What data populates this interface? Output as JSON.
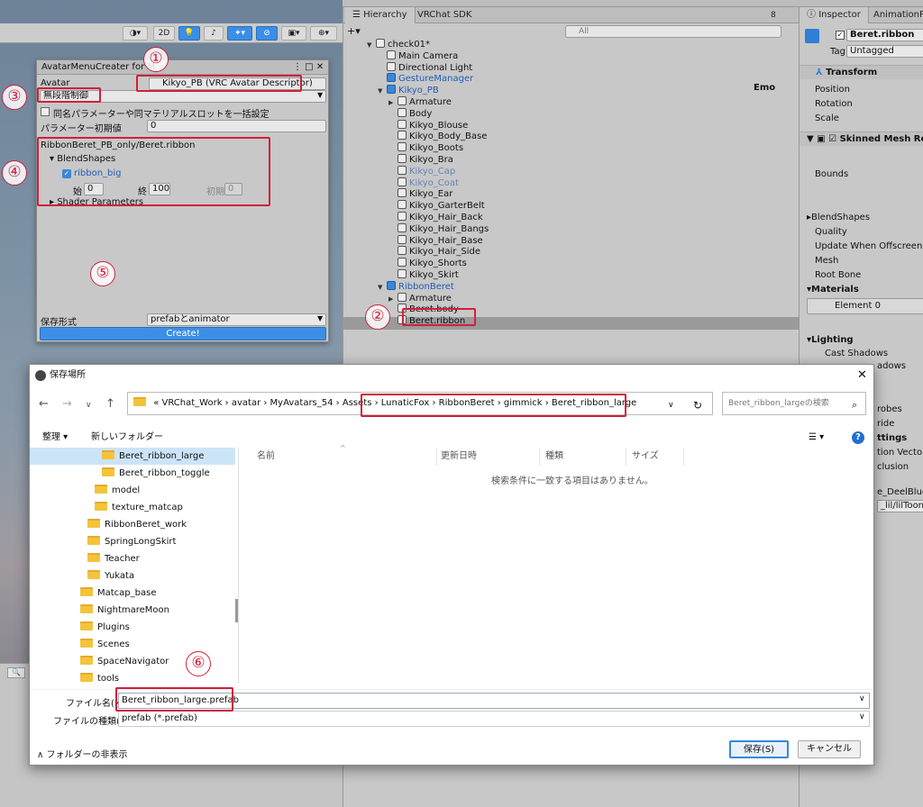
{
  "scene_toolbar": {
    "btn_2d": "2D"
  },
  "hierarchy": {
    "tabs": [
      "Hierarchy",
      "VRChat SDK"
    ],
    "tab_count": "8",
    "add_label": "+▾",
    "search_placeholder": "All",
    "items": [
      {
        "label": "check01*",
        "indent": 0,
        "arrow": "▼",
        "kind": "scene"
      },
      {
        "label": "Main Camera",
        "indent": 1,
        "arrow": "",
        "kind": "obj"
      },
      {
        "label": "Directional Light",
        "indent": 1,
        "arrow": "",
        "kind": "obj"
      },
      {
        "label": "GestureManager",
        "indent": 1,
        "arrow": "",
        "kind": "blue"
      },
      {
        "label": "Kikyo_PB",
        "indent": 1,
        "arrow": "▼",
        "kind": "blue"
      },
      {
        "label": "Armature",
        "indent": 2,
        "arrow": "▶",
        "kind": "obj"
      },
      {
        "label": "Body",
        "indent": 2,
        "arrow": "",
        "kind": "obj"
      },
      {
        "label": "Kikyo_Blouse",
        "indent": 2,
        "arrow": "",
        "kind": "obj"
      },
      {
        "label": "Kikyo_Body_Base",
        "indent": 2,
        "arrow": "",
        "kind": "obj"
      },
      {
        "label": "Kikyo_Boots",
        "indent": 2,
        "arrow": "",
        "kind": "obj"
      },
      {
        "label": "Kikyo_Bra",
        "indent": 2,
        "arrow": "",
        "kind": "obj"
      },
      {
        "label": "Kikyo_Cap",
        "indent": 2,
        "arrow": "",
        "kind": "dim"
      },
      {
        "label": "Kikyo_Coat",
        "indent": 2,
        "arrow": "",
        "kind": "dim"
      },
      {
        "label": "Kikyo_Ear",
        "indent": 2,
        "arrow": "",
        "kind": "obj"
      },
      {
        "label": "Kikyo_GarterBelt",
        "indent": 2,
        "arrow": "",
        "kind": "obj"
      },
      {
        "label": "Kikyo_Hair_Back",
        "indent": 2,
        "arrow": "",
        "kind": "obj"
      },
      {
        "label": "Kikyo_Hair_Bangs",
        "indent": 2,
        "arrow": "",
        "kind": "obj"
      },
      {
        "label": "Kikyo_Hair_Base",
        "indent": 2,
        "arrow": "",
        "kind": "obj"
      },
      {
        "label": "Kikyo_Hair_Side",
        "indent": 2,
        "arrow": "",
        "kind": "obj"
      },
      {
        "label": "Kikyo_Shorts",
        "indent": 2,
        "arrow": "",
        "kind": "obj"
      },
      {
        "label": "Kikyo_Skirt",
        "indent": 2,
        "arrow": "",
        "kind": "obj"
      },
      {
        "label": "RibbonBeret",
        "indent": 1,
        "arrow": "▼",
        "kind": "blue"
      },
      {
        "label": "Armature",
        "indent": 2,
        "arrow": "▶",
        "kind": "obj"
      },
      {
        "label": "Beret.body",
        "indent": 2,
        "arrow": "",
        "kind": "obj"
      },
      {
        "label": "Beret.ribbon",
        "indent": 2,
        "arrow": "",
        "kind": "obj"
      }
    ],
    "emo_label": "Emo"
  },
  "inspector": {
    "tabs": [
      "Inspector",
      "AnimationPla"
    ],
    "object_name": "Beret.ribbon",
    "tag_label": "Tag",
    "tag_value": "Untagged",
    "transform_header": "Transform",
    "transform_rows": [
      "Position",
      "Rotation",
      "Scale"
    ],
    "smr_header": "Skinned Mesh Rend",
    "bounds_label": "Bounds",
    "smr_rows": [
      "BlendShapes",
      "Quality",
      "Update When Offscreen",
      "Mesh",
      "Root Bone"
    ],
    "materials_header": "Materials",
    "element0": "Element 0",
    "lighting_header": "Lighting",
    "cast_shadows": "Cast Shadows",
    "partial_rows": [
      "adows",
      "robes",
      "ride",
      "ttings",
      "tion Vectors",
      "clusion"
    ],
    "material_name": "e_DeelBlue",
    "shader_name": "_lil/lilToonM"
  },
  "amc": {
    "title": "AvatarMenuCreater for M",
    "avatar_label": "Avatar",
    "avatar_value": "Kikyo_PB (VRC Avatar Descriptor)",
    "mode_value": "無段階制御",
    "checkbox_label": "同名パラメーターや同マテリアルスロットを一括設定",
    "param_init_label": "パラメーター初期値",
    "param_init_value": "0",
    "path_label": "RibbonBeret_PB_only/Beret.ribbon",
    "blendshapes_label": "BlendShapes",
    "shape_name": "ribbon_big",
    "start_label": "始",
    "start_value": "0",
    "end_label": "終",
    "end_value": "100",
    "init_label": "初期",
    "init_value": "0",
    "shader_params_label": "Shader Parameters",
    "save_format_label": "保存形式",
    "save_format_value": "prefabとanimator",
    "create_label": "Create!"
  },
  "annotations": [
    "①",
    "②",
    "③",
    "④",
    "⑤",
    "⑥"
  ],
  "dialog": {
    "title": "保存場所",
    "close": "✕",
    "breadcrumb": [
      "«",
      "VRChat_Work",
      "avatar",
      "MyAvatars_54",
      "Assets",
      "LunaticFox",
      "RibbonBeret",
      "gimmick",
      "Beret_ribbon_large"
    ],
    "search_placeholder": "Beret_ribbon_largeの検索",
    "organize": "整理 ▾",
    "new_folder": "新しいフォルダー",
    "columns": [
      "名前",
      "更新日時",
      "種類",
      "サイズ"
    ],
    "empty_message": "検索条件に一致する項目はありません。",
    "tree": [
      {
        "label": "Beret_ribbon_large",
        "indent": 3,
        "selected": true
      },
      {
        "label": "Beret_ribbon_toggle",
        "indent": 3,
        "selected": false
      },
      {
        "label": "model",
        "indent": 2,
        "selected": false
      },
      {
        "label": "texture_matcap",
        "indent": 2,
        "selected": false
      },
      {
        "label": "RibbonBeret_work",
        "indent": 1,
        "selected": false
      },
      {
        "label": "SpringLongSkirt",
        "indent": 1,
        "selected": false
      },
      {
        "label": "Teacher",
        "indent": 1,
        "selected": false
      },
      {
        "label": "Yukata",
        "indent": 1,
        "selected": false
      },
      {
        "label": "Matcap_base",
        "indent": 0,
        "selected": false
      },
      {
        "label": "NightmareMoon",
        "indent": 0,
        "selected": false
      },
      {
        "label": "Plugins",
        "indent": 0,
        "selected": false
      },
      {
        "label": "Scenes",
        "indent": 0,
        "selected": false
      },
      {
        "label": "SpaceNavigator",
        "indent": 0,
        "selected": false
      },
      {
        "label": "tools",
        "indent": 0,
        "selected": false
      }
    ],
    "filename_label": "ファイル名(N):",
    "filename_value": "Beret_ribbon_large.prefab",
    "filetype_label": "ファイルの種類(T):",
    "filetype_value": "prefab (*.prefab)",
    "hide_folders": "フォルダーの非表示",
    "save_button": "保存(S)",
    "cancel_button": "キャンセル"
  },
  "colors": {
    "accent": "#3a8ee6",
    "annotation_red": "#d0203a",
    "selection_blue": "#cce4f7"
  }
}
